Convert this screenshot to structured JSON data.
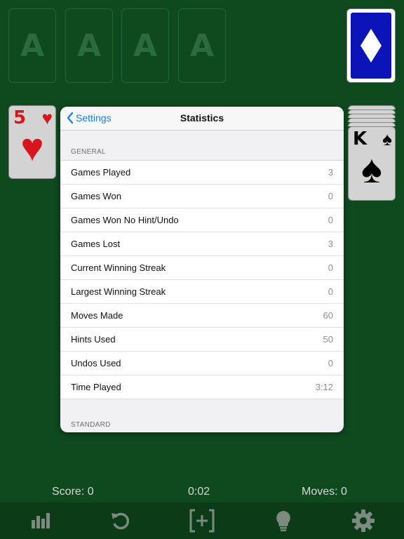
{
  "foundations": [
    "A",
    "A",
    "A",
    "A"
  ],
  "waste_card": {
    "rank": "5",
    "suit": "♥"
  },
  "tableau_card": {
    "rank": "K",
    "suit": "♠"
  },
  "deck_glyph": "◆",
  "modal": {
    "back_label": "Settings",
    "title": "Statistics",
    "section_general": "GENERAL",
    "rows": [
      {
        "label": "Games Played",
        "value": "3"
      },
      {
        "label": "Games Won",
        "value": "0"
      },
      {
        "label": "Games Won No Hint/Undo",
        "value": "0"
      },
      {
        "label": "Games Lost",
        "value": "3"
      },
      {
        "label": "Current Winning Streak",
        "value": "0"
      },
      {
        "label": "Largest Winning Streak",
        "value": "0"
      },
      {
        "label": "Moves Made",
        "value": "60"
      },
      {
        "label": "Hints Used",
        "value": "50"
      },
      {
        "label": "Undos Used",
        "value": "0"
      },
      {
        "label": "Time Played",
        "value": "3:12"
      }
    ],
    "section_standard": "STANDARD"
  },
  "status": {
    "score": "Score: 0",
    "time": "0:02",
    "moves": "Moves: 0"
  },
  "colors": {
    "felt": "#0f4a1f",
    "accent": "#1a7ef5",
    "deck_back": "#0a14b8",
    "card_red": "#d8141c"
  },
  "toolbar_icons": [
    "stats-icon",
    "undo-icon",
    "new-game-icon",
    "hint-icon",
    "gear-icon"
  ]
}
